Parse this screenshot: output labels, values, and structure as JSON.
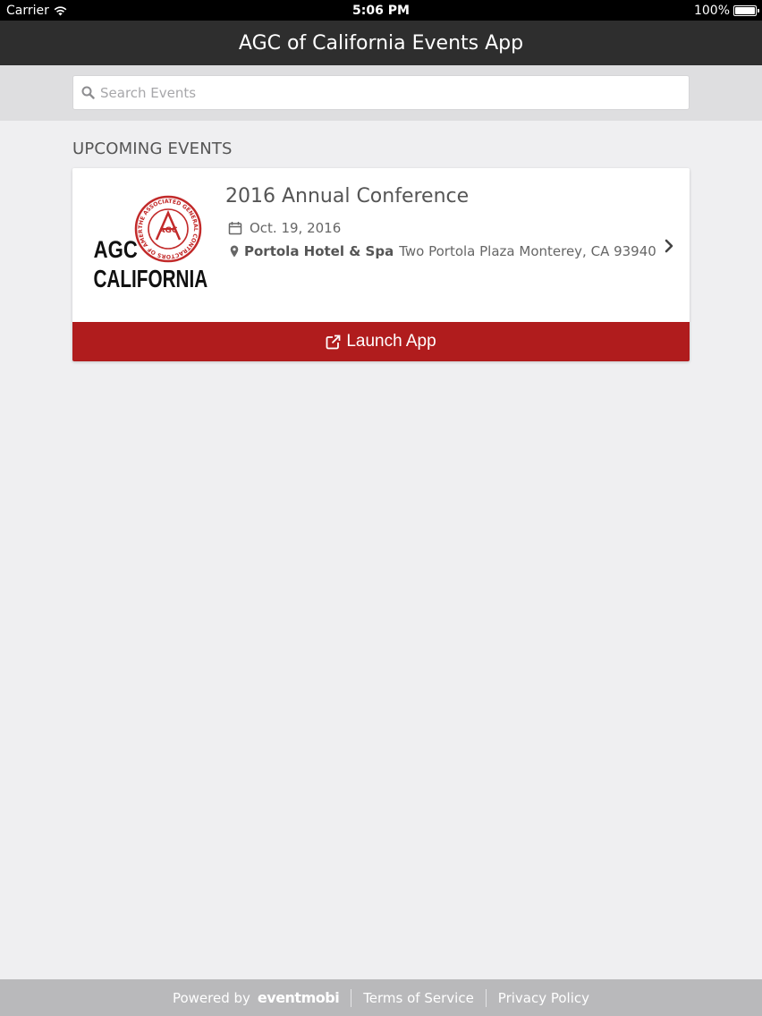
{
  "status_bar": {
    "carrier": "Carrier",
    "time": "5:06 PM",
    "battery": "100%"
  },
  "nav": {
    "title": "AGC of California Events App"
  },
  "search": {
    "placeholder": "Search Events",
    "value": ""
  },
  "section": {
    "title": "UPCOMING EVENTS"
  },
  "event": {
    "logo_text_line1": "AGC",
    "logo_text_line2": "CALIFORNIA",
    "seal_text": "THE ASSOCIATED GENERAL CONTRACTORS OF AMERICA",
    "seal_letters": "AGC",
    "title": "2016 Annual Conference",
    "date": "Oct. 19, 2016",
    "venue": "Portola Hotel & Spa",
    "address": "Two Portola Plaza Monterey, CA 93940",
    "launch_label": "Launch App"
  },
  "footer": {
    "powered_by": "Powered by",
    "brand": "eventmobi",
    "terms": "Terms of Service",
    "privacy": "Privacy Policy"
  },
  "colors": {
    "nav_bg": "#2e2e2e",
    "launch_bg": "#b01c1d",
    "seal_red": "#c22a2a",
    "footer_bg": "#b9b9bb"
  }
}
